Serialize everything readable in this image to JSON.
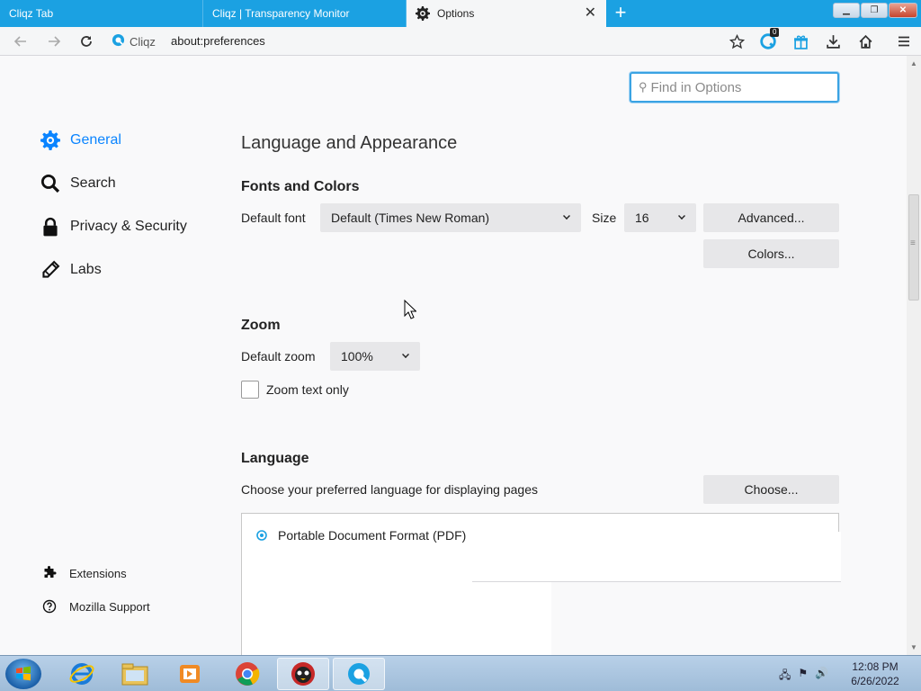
{
  "tabs": [
    {
      "label": "Cliqz Tab"
    },
    {
      "label": "Cliqz | Transparency Monitor"
    },
    {
      "label": "Options"
    }
  ],
  "nav": {
    "identity_label": "Cliqz",
    "url": "about:preferences",
    "cliqz_badge": "0"
  },
  "search": {
    "placeholder": "Find in Options"
  },
  "sidebar": {
    "categories": [
      {
        "label": "General",
        "icon": "gear-icon"
      },
      {
        "label": "Search",
        "icon": "search-icon"
      },
      {
        "label": "Privacy & Security",
        "icon": "lock-icon"
      },
      {
        "label": "Labs",
        "icon": "pencil-icon"
      }
    ],
    "footer": [
      {
        "label": "Extensions",
        "icon": "puzzle-icon"
      },
      {
        "label": "Mozilla Support",
        "icon": "help-icon"
      }
    ]
  },
  "main": {
    "title": "Language and Appearance",
    "fonts": {
      "title": "Fonts and Colors",
      "default_font_label": "Default font",
      "default_font_value": "Default (Times New Roman)",
      "size_label": "Size",
      "size_value": "16",
      "advanced_button": "Advanced...",
      "colors_button": "Colors..."
    },
    "zoom": {
      "title": "Zoom",
      "default_zoom_label": "Default zoom",
      "default_zoom_value": "100%",
      "zoom_text_only_label": "Zoom text only"
    },
    "language": {
      "title": "Language",
      "description": "Choose your preferred language for displaying pages",
      "choose_button": "Choose..."
    },
    "applications": {
      "row_label": "Portable Document Format (PDF)"
    }
  },
  "taskbar": {
    "clock_time": "12:08 PM",
    "clock_date": "6/26/2022"
  },
  "colors": {
    "accent": "#0a84ff",
    "tabbar": "#1ba1e2"
  }
}
